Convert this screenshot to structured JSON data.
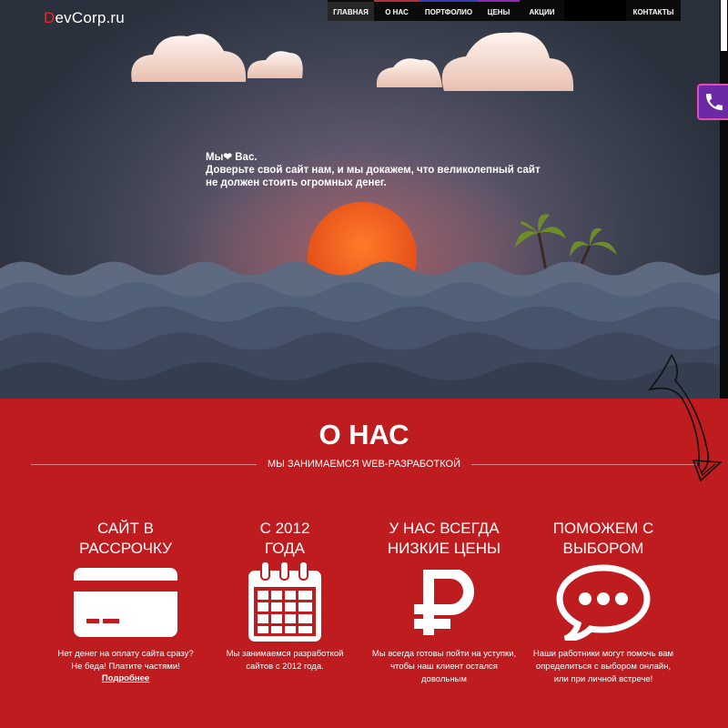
{
  "header": {
    "logo_first": "D",
    "logo_rest": "evCorp.ru",
    "nav": [
      "ГЛАВНАЯ",
      "О НАС",
      "ПОРТФОЛИО",
      "ЦЕНЫ",
      "АКЦИИ",
      "КОНТАКТЫ"
    ],
    "active_nav": "ГЛАВНАЯ"
  },
  "hero": {
    "line1_prefix": "Мы",
    "line1_suffix": " Вас.",
    "line2": "Доверьте свой сайт нам, и мы докажем, что великолепный сайт",
    "line3": "не должен стоить огромных денег."
  },
  "about": {
    "title": "О НАС",
    "subtitle": "МЫ ЗАНИМАЕМСЯ WEB-РАЗРАБОТКОЙ",
    "features": [
      {
        "title1": "САЙТ В",
        "title2": "РАССРОЧКУ",
        "icon": "credit-card-icon",
        "text1": "Нет денег на оплату сайта сразу?",
        "text2": "Не беда! Платите частями!",
        "link": "Подробнее"
      },
      {
        "title1": "С 2012",
        "title2": "ГОДА",
        "icon": "calendar-icon",
        "text1": "Мы занимаемся разработкой",
        "text2": "сайтов с 2012 года."
      },
      {
        "title1": "У НАС ВСЕГДА",
        "title2": "НИЗКИЕ ЦЕНЫ",
        "icon": "ruble-icon",
        "text1": "Мы всегда готовы пойти на уступки,",
        "text2": "чтобы наш клиент остался",
        "text3": "довольным"
      },
      {
        "title1": "ПОМОЖЕМ С",
        "title2": "ВЫБОРОМ",
        "icon": "chat-bubble-icon",
        "text1": "Наши работники могут помочь вам",
        "text2": "определиться с выбором онлайн,",
        "text3": "или при личной встрече!"
      }
    ]
  },
  "colors": {
    "brand_red": "#be1c1f",
    "logo_accent": "#e02b2b",
    "phone_purple": "#6b2aa3",
    "sun": "#f0581e"
  }
}
